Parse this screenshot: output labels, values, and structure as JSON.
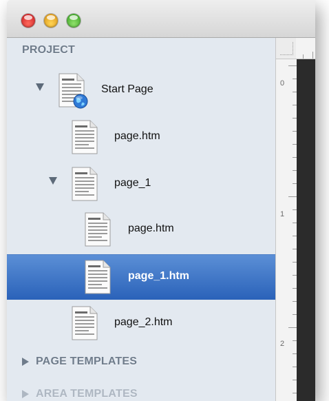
{
  "window": {
    "traffic_lights": {
      "close_color": "#d83a2e",
      "minimize_color": "#f0b429",
      "zoom_color": "#5cbf3a"
    }
  },
  "sidebar": {
    "project_header": "PROJECT",
    "tree": [
      {
        "label": "Start Page",
        "icon": "start-page-icon",
        "disclosure": "expanded",
        "selected": false
      },
      {
        "label": "page.htm",
        "icon": "document-icon",
        "selected": false
      },
      {
        "label": "page_1",
        "icon": "document-icon",
        "disclosure": "expanded",
        "selected": false
      },
      {
        "label": "page.htm",
        "icon": "document-icon",
        "selected": false
      },
      {
        "label": "page_1.htm",
        "icon": "document-icon",
        "selected": true
      },
      {
        "label": "page_2.htm",
        "icon": "document-icon",
        "selected": false
      }
    ],
    "page_templates_header": "PAGE TEMPLATES",
    "area_templates_header": "AREA TEMPLATES"
  },
  "ruler": {
    "labels": [
      "0",
      "1",
      "2"
    ]
  },
  "colors": {
    "sidebar_bg": "#e3e9f0",
    "selection": "#2a62b9",
    "header_text": "#6f7c8b"
  }
}
